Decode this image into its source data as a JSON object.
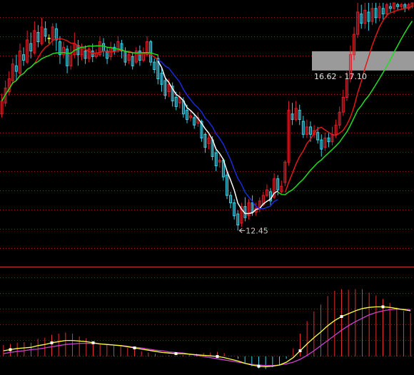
{
  "colors": {
    "background": "#000000",
    "grid": "#8b1a1a",
    "divider": "#c83232",
    "up_candle": "#e0202a",
    "down_candle": "#3fd0e8",
    "flat_candle": "#e8e83a",
    "ma_fast": "#ffffff",
    "ma_slow_bear": "#1a2bd6",
    "ma_mid": "#e01818",
    "ma_long": "#22dd22",
    "zone_band": "#9a9a9a",
    "macd_dif": "#ffff40",
    "macd_dea": "#d040d0",
    "hist_pos": "#e03030",
    "hist_neg": "#3fd0e8",
    "marker": "#ffffff"
  },
  "chart_data": [
    {
      "type": "candlestick",
      "title": "",
      "xlabel": "",
      "ylabel": "",
      "ylim": [
        11.9,
        18.6
      ],
      "grid": true,
      "annotations": {
        "low_label": "12.45",
        "low_value": 12.45,
        "zone_label": "16.62 - 17.10",
        "zone_low": 16.62,
        "zone_high": 17.1
      },
      "candles": [
        [
          15.6,
          15.95,
          16.15,
          15.5
        ],
        [
          15.9,
          16.3,
          16.5,
          15.8
        ],
        [
          16.2,
          16.55,
          16.75,
          16.1
        ],
        [
          16.5,
          16.95,
          17.1,
          16.4
        ],
        [
          16.9,
          16.75,
          17.2,
          16.5
        ],
        [
          16.7,
          17.3,
          17.5,
          16.6
        ],
        [
          17.2,
          17.05,
          17.4,
          16.9
        ],
        [
          17.0,
          17.6,
          17.85,
          16.95
        ],
        [
          17.5,
          17.3,
          17.8,
          17.1
        ],
        [
          17.25,
          17.85,
          18.1,
          17.2
        ],
        [
          17.8,
          17.55,
          18.0,
          17.4
        ],
        [
          17.5,
          17.95,
          18.2,
          17.45
        ],
        [
          17.9,
          17.7,
          18.1,
          17.55
        ],
        [
          17.65,
          17.65,
          17.75,
          17.5
        ],
        [
          17.6,
          17.95,
          18.05,
          17.45
        ],
        [
          17.9,
          17.6,
          18.05,
          17.3
        ],
        [
          17.55,
          17.2,
          17.7,
          16.95
        ],
        [
          17.2,
          17.4,
          17.55,
          17.1
        ],
        [
          17.35,
          16.9,
          17.45,
          16.7
        ],
        [
          16.9,
          17.25,
          17.45,
          16.8
        ],
        [
          17.2,
          17.5,
          17.8,
          17.1
        ],
        [
          17.45,
          17.2,
          17.6,
          16.9
        ],
        [
          17.2,
          17.35,
          17.5,
          17.05
        ],
        [
          17.3,
          17.1,
          17.45,
          16.95
        ],
        [
          17.1,
          17.35,
          17.45,
          17.0
        ],
        [
          17.3,
          17.15,
          17.5,
          17.0
        ],
        [
          17.15,
          17.25,
          17.35,
          17.1
        ],
        [
          17.2,
          17.55,
          17.7,
          17.15
        ],
        [
          17.5,
          17.3,
          17.65,
          17.15
        ],
        [
          17.3,
          17.1,
          17.4,
          16.95
        ],
        [
          17.15,
          17.4,
          17.55,
          17.05
        ],
        [
          17.4,
          17.3,
          17.5,
          17.2
        ],
        [
          17.3,
          17.55,
          17.7,
          17.25
        ],
        [
          17.5,
          17.3,
          17.6,
          17.1
        ],
        [
          17.3,
          17.0,
          17.4,
          16.9
        ],
        [
          17.05,
          17.2,
          17.3,
          16.95
        ],
        [
          17.15,
          16.9,
          17.25,
          16.8
        ],
        [
          17.0,
          17.3,
          17.4,
          16.95
        ],
        [
          17.3,
          17.05,
          17.45,
          16.9
        ],
        [
          17.05,
          17.25,
          17.4,
          17.0
        ],
        [
          17.2,
          17.55,
          17.7,
          17.15
        ],
        [
          17.55,
          17.0,
          17.6,
          16.9
        ],
        [
          17.0,
          16.8,
          17.1,
          16.7
        ],
        [
          17.1,
          16.55,
          17.2,
          16.4
        ],
        [
          16.7,
          16.4,
          16.85,
          16.2
        ],
        [
          16.5,
          16.1,
          16.6,
          16.0
        ],
        [
          16.2,
          16.4,
          16.55,
          16.05
        ],
        [
          16.35,
          15.95,
          16.45,
          15.8
        ],
        [
          16.05,
          15.8,
          16.2,
          15.7
        ],
        [
          15.9,
          16.05,
          16.2,
          15.75
        ],
        [
          15.95,
          15.6,
          16.05,
          15.5
        ],
        [
          15.7,
          15.45,
          15.85,
          15.35
        ],
        [
          15.5,
          15.55,
          15.7,
          15.4
        ],
        [
          15.5,
          15.3,
          15.6,
          15.2
        ],
        [
          15.35,
          15.5,
          15.65,
          15.25
        ],
        [
          15.4,
          14.95,
          15.45,
          14.85
        ],
        [
          15.05,
          14.7,
          15.1,
          14.55
        ],
        [
          14.8,
          14.95,
          15.05,
          14.65
        ],
        [
          14.9,
          14.45,
          15.0,
          14.35
        ],
        [
          14.55,
          14.2,
          14.65,
          14.05
        ],
        [
          14.3,
          14.35,
          14.5,
          14.15
        ],
        [
          14.35,
          13.9,
          14.4,
          13.8
        ],
        [
          13.95,
          13.4,
          14.05,
          13.3
        ],
        [
          13.4,
          13.2,
          13.5,
          13.05
        ],
        [
          13.2,
          12.85,
          13.3,
          12.75
        ],
        [
          12.9,
          12.6,
          13.0,
          12.45
        ],
        [
          12.65,
          13.1,
          13.2,
          12.55
        ],
        [
          13.1,
          12.8,
          13.35,
          12.7
        ],
        [
          12.85,
          13.2,
          13.3,
          12.75
        ],
        [
          13.2,
          12.95,
          13.4,
          12.85
        ],
        [
          12.95,
          13.05,
          13.2,
          12.85
        ],
        [
          13.05,
          13.25,
          13.35,
          12.95
        ],
        [
          13.15,
          13.4,
          13.5,
          13.1
        ],
        [
          13.4,
          13.55,
          13.7,
          13.35
        ],
        [
          13.5,
          13.25,
          13.6,
          13.1
        ],
        [
          13.35,
          13.85,
          14.0,
          13.3
        ],
        [
          13.85,
          13.55,
          13.95,
          13.4
        ],
        [
          13.5,
          13.65,
          13.8,
          13.45
        ],
        [
          13.75,
          14.3,
          14.35,
          13.65
        ],
        [
          14.3,
          15.7,
          15.95,
          14.2
        ],
        [
          15.6,
          15.45,
          15.9,
          15.3
        ],
        [
          15.45,
          15.75,
          15.95,
          15.4
        ],
        [
          15.7,
          15.45,
          15.85,
          15.3
        ],
        [
          15.4,
          15.05,
          15.55,
          14.95
        ],
        [
          15.05,
          15.25,
          15.45,
          14.95
        ],
        [
          15.25,
          15.05,
          15.4,
          14.85
        ],
        [
          15.05,
          15.15,
          15.3,
          14.95
        ],
        [
          15.1,
          14.9,
          15.25,
          14.8
        ],
        [
          14.9,
          14.65,
          15.05,
          14.45
        ],
        [
          14.7,
          14.95,
          15.1,
          14.6
        ],
        [
          14.95,
          14.85,
          15.1,
          14.7
        ],
        [
          14.85,
          15.05,
          15.25,
          14.75
        ],
        [
          15.05,
          15.3,
          15.45,
          14.95
        ],
        [
          15.3,
          15.65,
          15.8,
          15.2
        ],
        [
          15.65,
          16.05,
          16.25,
          15.55
        ],
        [
          16.05,
          16.55,
          16.75,
          15.95
        ],
        [
          16.55,
          17.2,
          17.45,
          16.45
        ],
        [
          17.2,
          17.75,
          17.95,
          17.05
        ],
        [
          17.75,
          18.35,
          18.6,
          17.65
        ],
        [
          18.3,
          18.05,
          18.55,
          17.9
        ],
        [
          18.05,
          18.4,
          18.6,
          17.9
        ],
        [
          18.35,
          18.1,
          18.6,
          17.85
        ],
        [
          18.1,
          18.45,
          18.6,
          18.0
        ],
        [
          18.45,
          18.2,
          18.6,
          18.05
        ],
        [
          18.2,
          18.5,
          18.6,
          18.1
        ],
        [
          18.45,
          18.3,
          18.6,
          18.15
        ],
        [
          18.3,
          18.55,
          18.6,
          18.2
        ],
        [
          18.5,
          18.45,
          18.6,
          18.35
        ],
        [
          18.45,
          18.6,
          18.6,
          18.3
        ],
        [
          18.55,
          18.5,
          18.6,
          18.4
        ],
        [
          18.5,
          18.55,
          18.6,
          18.4
        ],
        [
          18.55,
          18.45,
          18.6,
          18.35
        ],
        [
          18.45,
          18.55,
          18.6,
          18.4
        ],
        [
          18.5,
          18.6,
          18.6,
          18.45
        ]
      ]
    },
    {
      "type": "line",
      "title": "",
      "xlabel": "",
      "ylabel": "",
      "ylim": [
        -0.3,
        1.0
      ],
      "series": [
        {
          "key": "dif",
          "values": [
            0.1,
            0.12,
            0.14,
            0.15,
            0.16,
            0.19,
            0.21,
            0.24,
            0.26,
            0.28,
            0.28,
            0.27,
            0.26,
            0.24,
            0.22,
            0.21,
            0.2,
            0.19,
            0.17,
            0.15,
            0.13,
            0.11,
            0.09,
            0.07,
            0.06,
            0.05,
            0.05,
            0.04,
            0.03,
            0.02,
            0.01,
            0.0,
            -0.02,
            -0.05,
            -0.08,
            -0.12,
            -0.15,
            -0.17,
            -0.18,
            -0.17,
            -0.15,
            -0.1,
            -0.02,
            0.1,
            0.22,
            0.33,
            0.43,
            0.54,
            0.63,
            0.7,
            0.75,
            0.8,
            0.84,
            0.86,
            0.87,
            0.87,
            0.86,
            0.84,
            0.82,
            0.8
          ]
        },
        {
          "key": "dea",
          "values": [
            0.05,
            0.07,
            0.09,
            0.1,
            0.12,
            0.13,
            0.15,
            0.17,
            0.19,
            0.21,
            0.22,
            0.23,
            0.23,
            0.23,
            0.22,
            0.21,
            0.2,
            0.19,
            0.18,
            0.16,
            0.15,
            0.13,
            0.11,
            0.1,
            0.08,
            0.07,
            0.06,
            0.04,
            0.02,
            0.0,
            -0.02,
            -0.04,
            -0.06,
            -0.08,
            -0.1,
            -0.12,
            -0.14,
            -0.15,
            -0.16,
            -0.16,
            -0.15,
            -0.13,
            -0.1,
            -0.05,
            0.02,
            0.1,
            0.19,
            0.28,
            0.37,
            0.46,
            0.54,
            0.61,
            0.67,
            0.73,
            0.77,
            0.8,
            0.82,
            0.83,
            0.83,
            0.82
          ]
        }
      ]
    }
  ]
}
